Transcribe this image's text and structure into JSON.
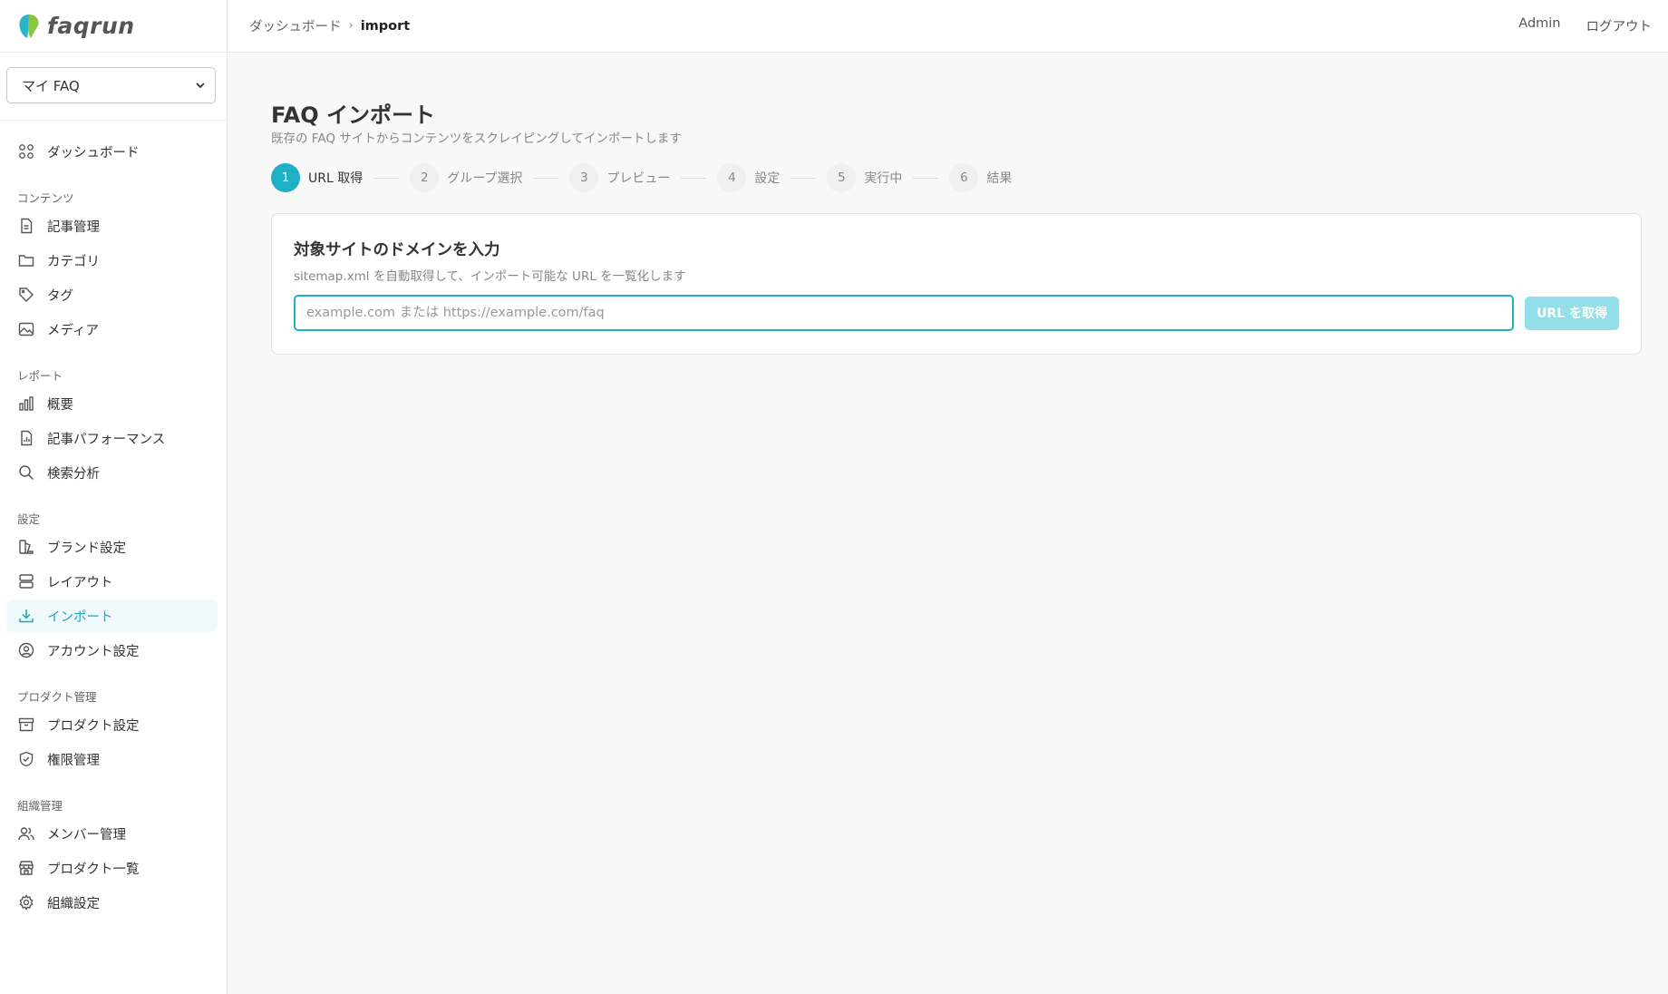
{
  "brand": {
    "name": "faqrun"
  },
  "product_selector": {
    "value": "マイ FAQ"
  },
  "nav": {
    "dashboard": "ダッシュボード",
    "sections": [
      {
        "title": "コンテンツ",
        "items": [
          "記事管理",
          "カテゴリ",
          "タグ",
          "メディア"
        ]
      },
      {
        "title": "レポート",
        "items": [
          "概要",
          "記事パフォーマンス",
          "検索分析"
        ]
      },
      {
        "title": "設定",
        "items": [
          "ブランド設定",
          "レイアウト",
          "インポート",
          "アカウント設定"
        ]
      },
      {
        "title": "プロダクト管理",
        "items": [
          "プロダクト設定",
          "権限管理"
        ]
      },
      {
        "title": "組織管理",
        "items": [
          "メンバー管理",
          "プロダクト一覧",
          "組織設定"
        ]
      }
    ],
    "active_item": "インポート"
  },
  "header": {
    "breadcrumb": [
      "ダッシュボード",
      "import"
    ],
    "user": "Admin",
    "logout": "ログアウト"
  },
  "page": {
    "title": "FAQ インポート",
    "subtitle": "既存の FAQ サイトからコンテンツをスクレイピングしてインポートします"
  },
  "steps": [
    {
      "num": "1",
      "label": "URL 取得",
      "active": true
    },
    {
      "num": "2",
      "label": "グループ選択"
    },
    {
      "num": "3",
      "label": "プレビュー"
    },
    {
      "num": "4",
      "label": "設定"
    },
    {
      "num": "5",
      "label": "実行中"
    },
    {
      "num": "6",
      "label": "結果"
    }
  ],
  "card": {
    "title": "対象サイトのドメインを入力",
    "description": "sitemap.xml を自動取得して、インポート可能な URL を一覧化します",
    "input_placeholder": "example.com または https://example.com/faq",
    "input_value": "",
    "button_label": "URL を取得"
  },
  "colors": {
    "accent": "#1eb0c6",
    "button_disabled": "#92dfe9",
    "active_bg": "#f0fafc"
  }
}
